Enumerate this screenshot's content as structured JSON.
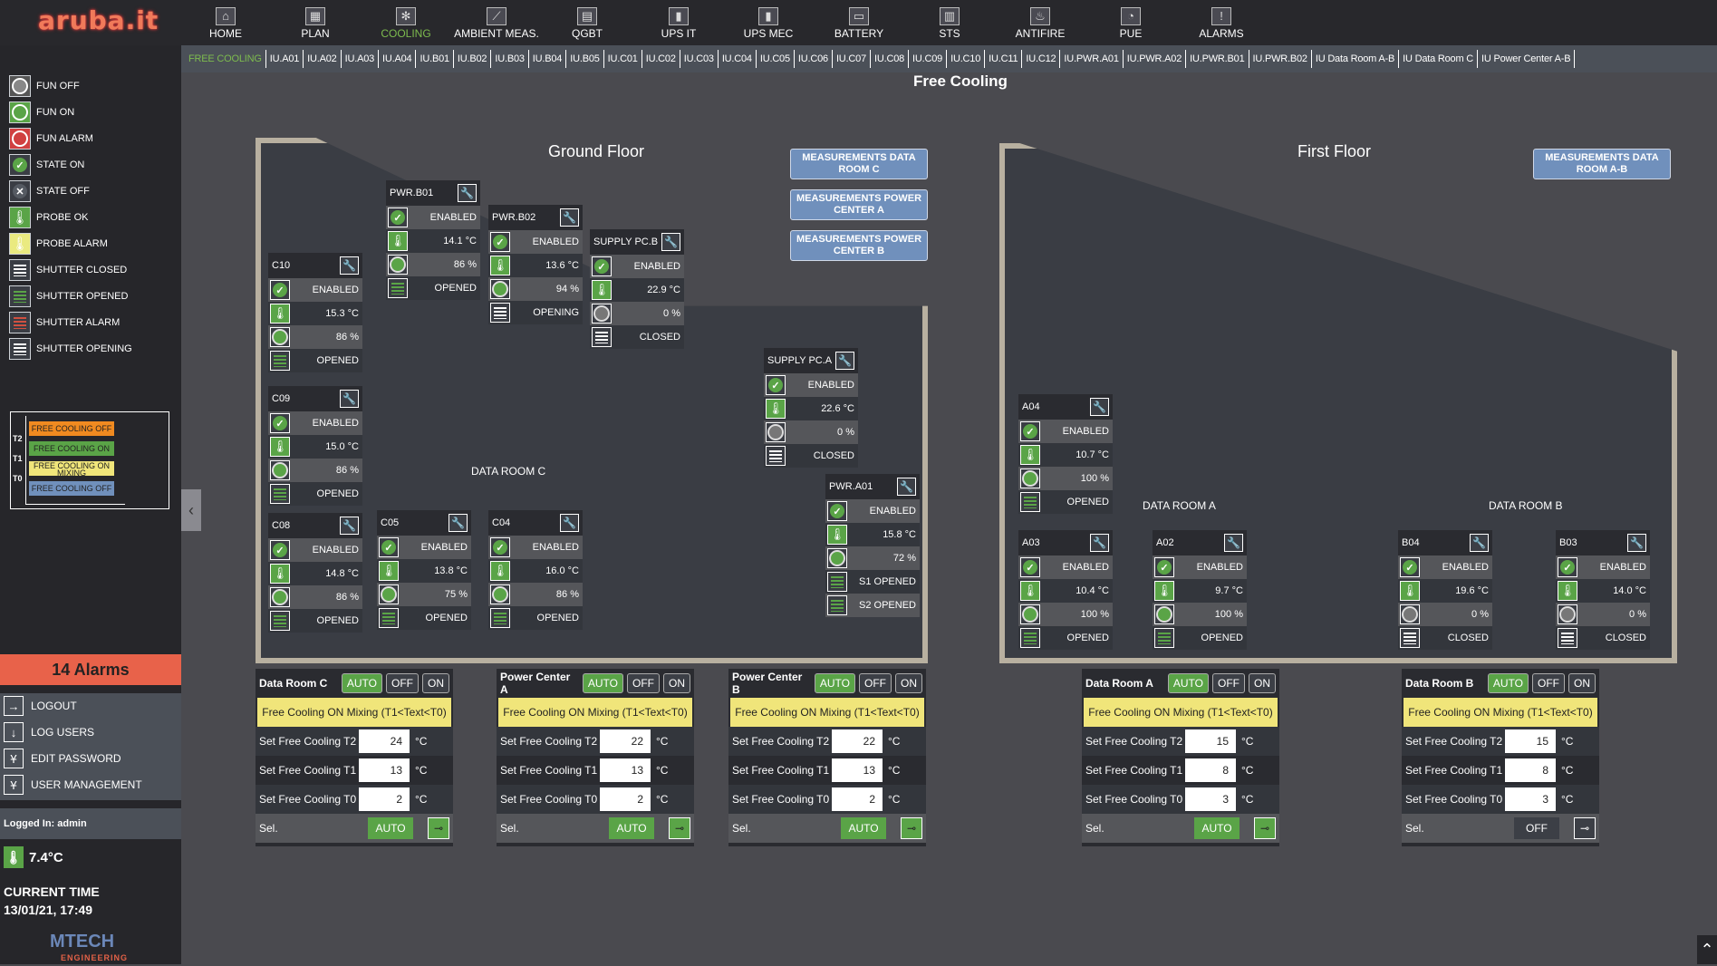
{
  "logo": "aruba.it",
  "nav": [
    {
      "label": "HOME",
      "icon": "home-icon"
    },
    {
      "label": "PLAN",
      "icon": "plan-icon"
    },
    {
      "label": "COOLING",
      "icon": "snowflake-icon",
      "active": true
    },
    {
      "label": "AMBIENT MEAS.",
      "icon": "gauge-icon"
    },
    {
      "label": "QGBT",
      "icon": "panel-icon"
    },
    {
      "label": "UPS IT",
      "icon": "ups-icon"
    },
    {
      "label": "UPS MEC",
      "icon": "ups-icon"
    },
    {
      "label": "BATTERY",
      "icon": "battery-icon"
    },
    {
      "label": "STS",
      "icon": "switch-icon"
    },
    {
      "label": "ANTIFIRE",
      "icon": "flame-icon"
    },
    {
      "label": "PUE",
      "icon": "pie-icon"
    },
    {
      "label": "ALARMS",
      "icon": "exclamation-icon"
    }
  ],
  "tabs": [
    "FREE COOLING",
    "IU.A01",
    "IU.A02",
    "IU.A03",
    "IU.A04",
    "IU.B01",
    "IU.B02",
    "IU.B03",
    "IU.B04",
    "IU.B05",
    "IU.C01",
    "IU.C02",
    "IU.C03",
    "IU.C04",
    "IU.C05",
    "IU.C06",
    "IU.C07",
    "IU.C08",
    "IU.C09",
    "IU.C10",
    "IU.C11",
    "IU.C12",
    "IU.PWR.A01",
    "IU.PWR.A02",
    "IU.PWR.B01",
    "IU.PWR.B02",
    "IU Data Room A-B",
    "IU Data Room C",
    "IU Power Center A-B"
  ],
  "active_tab": "FREE COOLING",
  "legend": [
    {
      "label": "FUN OFF",
      "type": "fan",
      "color": "#888888"
    },
    {
      "label": "FUN ON",
      "type": "fan",
      "color": "#5aa447"
    },
    {
      "label": "FUN ALARM",
      "type": "fan",
      "color": "#d04040"
    },
    {
      "label": "STATE ON",
      "type": "check",
      "color": "#5aa447"
    },
    {
      "label": "STATE OFF",
      "type": "cross",
      "color": "#555a62"
    },
    {
      "label": "PROBE OK",
      "type": "probe",
      "color": "#5aa447"
    },
    {
      "label": "PROBE ALARM",
      "type": "probe",
      "color": "#eaea80"
    },
    {
      "label": "SHUTTER CLOSED",
      "type": "shutter",
      "color": "#ffffff"
    },
    {
      "label": "SHUTTER OPENED",
      "type": "shutter",
      "color": "#5aa447"
    },
    {
      "label": "SHUTTER ALARM",
      "type": "shutter",
      "color": "#d05040"
    },
    {
      "label": "SHUTTER OPENING",
      "type": "shutter",
      "color": "#ffffff"
    }
  ],
  "fc_legend": {
    "levels": [
      "T2",
      "T1",
      "T0"
    ],
    "bands": [
      {
        "label": "FREE COOLING OFF",
        "color": "#f08a20"
      },
      {
        "label": "FREE COOLING ON",
        "color": "#5aa447"
      },
      {
        "label": "FREE COOLING ON MIXING",
        "color": "#f0e57a"
      },
      {
        "label": "FREE COOLING OFF",
        "color": "#7090bc"
      }
    ]
  },
  "alarms": "14 Alarms",
  "user_menu": [
    {
      "label": "LOGOUT",
      "icon": "→"
    },
    {
      "label": "LOG USERS",
      "icon": "↓"
    },
    {
      "label": "EDIT PASSWORD",
      "icon": "Ұ"
    },
    {
      "label": "USER MANAGEMENT",
      "icon": "Ұ"
    }
  ],
  "logged_in": "Logged In: admin",
  "outside_temp": "7.4°C",
  "current_time_label": "CURRENT TIME",
  "current_time": "13/01/21, 17:49",
  "vendor": {
    "name": "MTECH",
    "sub": "ENGINEERING"
  },
  "page_title": "Free Cooling",
  "floors": [
    {
      "title": "Ground Floor",
      "rooms": [
        "DATA ROOM C"
      ]
    },
    {
      "title": "First Floor",
      "rooms": [
        "DATA ROOM A",
        "DATA ROOM B"
      ]
    }
  ],
  "measurement_buttons": [
    "MEASUREMENTS DATA ROOM C",
    "MEASUREMENTS POWER CENTER A",
    "MEASUREMENTS POWER CENTER B",
    "MEASUREMENTS DATA ROOM A-B"
  ],
  "units": [
    {
      "name": "PWR.B01",
      "state": "ENABLED",
      "temp": "14.1 °C",
      "fan": "86 %",
      "fan_on": true,
      "shutter": [
        "OPENED"
      ]
    },
    {
      "name": "PWR.B02",
      "state": "ENABLED",
      "temp": "13.6 °C",
      "fan": "94 %",
      "fan_on": true,
      "shutter": [
        "OPENING"
      ]
    },
    {
      "name": "SUPPLY PC.B",
      "state": "ENABLED",
      "temp": "22.9 °C",
      "fan": "0 %",
      "fan_on": false,
      "shutter": [
        "CLOSED"
      ]
    },
    {
      "name": "C10",
      "state": "ENABLED",
      "temp": "15.3 °C",
      "fan": "86 %",
      "fan_on": true,
      "shutter": [
        "OPENED"
      ]
    },
    {
      "name": "C09",
      "state": "ENABLED",
      "temp": "15.0 °C",
      "fan": "86 %",
      "fan_on": true,
      "shutter": [
        "OPENED"
      ]
    },
    {
      "name": "C08",
      "state": "ENABLED",
      "temp": "14.8 °C",
      "fan": "86 %",
      "fan_on": true,
      "shutter": [
        "OPENED"
      ]
    },
    {
      "name": "C05",
      "state": "ENABLED",
      "temp": "13.8 °C",
      "fan": "75 %",
      "fan_on": true,
      "shutter": [
        "OPENED"
      ]
    },
    {
      "name": "C04",
      "state": "ENABLED",
      "temp": "16.0 °C",
      "fan": "86 %",
      "fan_on": true,
      "shutter": [
        "OPENED"
      ]
    },
    {
      "name": "SUPPLY PC.A",
      "state": "ENABLED",
      "temp": "22.6 °C",
      "fan": "0 %",
      "fan_on": false,
      "shutter": [
        "CLOSED"
      ]
    },
    {
      "name": "PWR.A01",
      "state": "ENABLED",
      "temp": "15.8 °C",
      "fan": "72 %",
      "fan_on": true,
      "shutter": [
        "S1 OPENED",
        "S2 OPENED"
      ]
    },
    {
      "name": "A04",
      "state": "ENABLED",
      "temp": "10.7 °C",
      "fan": "100 %",
      "fan_on": true,
      "shutter": [
        "OPENED"
      ]
    },
    {
      "name": "A03",
      "state": "ENABLED",
      "temp": "10.4 °C",
      "fan": "100 %",
      "fan_on": true,
      "shutter": [
        "OPENED"
      ]
    },
    {
      "name": "A02",
      "state": "ENABLED",
      "temp": "9.7 °C",
      "fan": "100 %",
      "fan_on": true,
      "shutter": [
        "OPENED"
      ]
    },
    {
      "name": "B04",
      "state": "ENABLED",
      "temp": "19.6 °C",
      "fan": "0 %",
      "fan_on": false,
      "shutter": [
        "CLOSED"
      ]
    },
    {
      "name": "B03",
      "state": "ENABLED",
      "temp": "14.0 °C",
      "fan": "0 %",
      "fan_on": false,
      "shutter": [
        "CLOSED"
      ]
    }
  ],
  "controls": [
    {
      "name": "Data Room C",
      "buttons": [
        "AUTO",
        "OFF",
        "ON"
      ],
      "active": "AUTO",
      "status": "Free Cooling ON Mixing (T1<Text<T0)",
      "t2": "24",
      "t1": "13",
      "t0": "2",
      "unit": "°C",
      "sel_label": "Sel.",
      "sel": "AUTO"
    },
    {
      "name": "Power Center A",
      "buttons": [
        "AUTO",
        "OFF",
        "ON"
      ],
      "active": "AUTO",
      "status": "Free Cooling ON Mixing (T1<Text<T0)",
      "t2": "22",
      "t1": "13",
      "t0": "2",
      "unit": "°C",
      "sel_label": "Sel.",
      "sel": "AUTO"
    },
    {
      "name": "Power Center B",
      "buttons": [
        "AUTO",
        "OFF",
        "ON"
      ],
      "active": "AUTO",
      "status": "Free Cooling ON Mixing (T1<Text<T0)",
      "t2": "22",
      "t1": "13",
      "t0": "2",
      "unit": "°C",
      "sel_label": "Sel.",
      "sel": "AUTO"
    },
    {
      "name": "Data Room A",
      "buttons": [
        "AUTO",
        "OFF",
        "ON"
      ],
      "active": "AUTO",
      "status": "Free Cooling ON Mixing (T1<Text<T0)",
      "t2": "15",
      "t1": "8",
      "t0": "3",
      "unit": "°C",
      "sel_label": "Sel.",
      "sel": "AUTO"
    },
    {
      "name": "Data Room B",
      "buttons": [
        "AUTO",
        "OFF",
        "ON"
      ],
      "active": "AUTO",
      "status": "Free Cooling ON Mixing (T1<Text<T0)",
      "t2": "15",
      "t1": "8",
      "t0": "3",
      "unit": "°C",
      "sel_label": "Sel.",
      "sel": "OFF"
    }
  ],
  "set_labels": {
    "t2": "Set Free Cooling T2",
    "t1": "Set Free Cooling T1",
    "t0": "Set Free Cooling T0"
  },
  "colors": {
    "accent_green": "#5aa447",
    "alarm_red": "#e8624a",
    "status_yellow": "#f0e57a",
    "meas_blue": "#7090bc"
  }
}
